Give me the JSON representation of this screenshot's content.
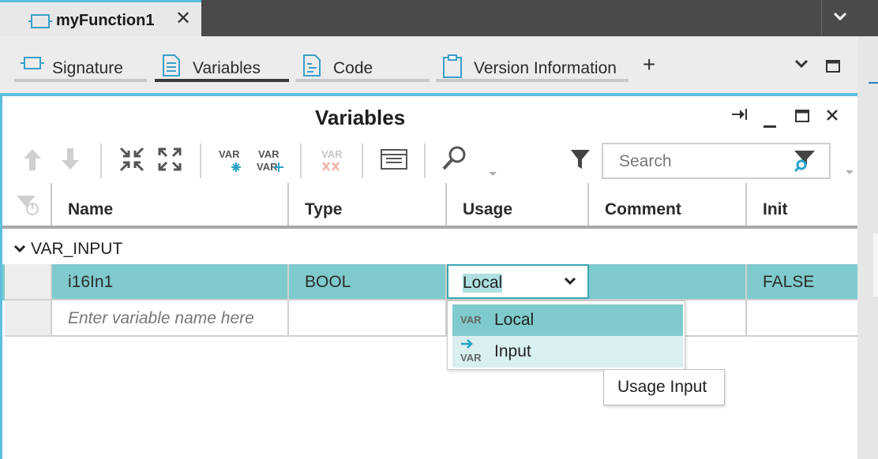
{
  "document_tab": {
    "title": "myFunction1",
    "close": "✕"
  },
  "sub_tabs": [
    {
      "label": "Signature",
      "icon": "signature-icon"
    },
    {
      "label": "Variables",
      "icon": "variables-icon",
      "active": true
    },
    {
      "label": "Code",
      "icon": "code-icon"
    },
    {
      "label": "Version Information",
      "icon": "clipboard-icon"
    }
  ],
  "add_tab": "+",
  "panel": {
    "title": "Variables"
  },
  "search": {
    "placeholder": "Search"
  },
  "toolbar": {
    "var_label": "VAR",
    "icons": [
      "move-up-icon",
      "move-down-icon",
      "collapse-all-icon",
      "expand-all-icon",
      "add-var-icon",
      "add-var-multi-icon",
      "delete-var-icon",
      "table-view-icon",
      "find-icon",
      "filter-icon"
    ]
  },
  "columns": [
    "Name",
    "Type",
    "Usage",
    "Comment",
    "Init"
  ],
  "group": {
    "label": "VAR_INPUT"
  },
  "rows": [
    {
      "name": "i16In1",
      "type": "BOOL",
      "usage": "Local",
      "comment": "",
      "init": "FALSE"
    }
  ],
  "new_row": {
    "placeholder": "Enter variable name here"
  },
  "usage_menu": {
    "items": [
      {
        "label": "Local",
        "icon_text": "VAR"
      },
      {
        "label": "Input",
        "icon_text": "VAR"
      }
    ],
    "tooltip": "Usage Input"
  },
  "colors": {
    "accent": "#5bc0de",
    "selection": "#7fcacd",
    "hover": "#d9eff0",
    "dark_bar": "#4a4a4a"
  }
}
